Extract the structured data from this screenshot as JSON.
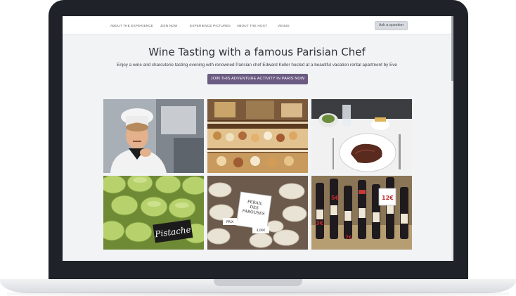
{
  "nav": {
    "items": [
      {
        "label": "About the experience"
      },
      {
        "label": "Join now"
      },
      {
        "label": "Experience pictures"
      },
      {
        "label": "About the host"
      },
      {
        "label": "Venue"
      }
    ],
    "ask_label": "Ask a question"
  },
  "hero": {
    "title": "Wine Tasting with a famous Parisian Chef",
    "subtitle": "Enjoy a wine and charcuterie tasting evening with renowned Parisian chef Edward Keller hosted at a beautiful vacation rental apartment by Eve",
    "cta_label": "JOIN THIS ADVENTURE ACTIVITY IN PARIS NOW"
  },
  "gallery": {
    "photos": [
      {
        "icon": "chef-photo"
      },
      {
        "icon": "pastry-display-photo"
      },
      {
        "icon": "steak-dish-photo"
      },
      {
        "icon": "macarons-photo",
        "label": "Pistache"
      },
      {
        "icon": "cheese-photo",
        "label_lines": [
          "PERAIL",
          "DES",
          "FAROUSES"
        ],
        "tag": "PRIX",
        "price": "3,00€"
      },
      {
        "icon": "wine-bottles-photo",
        "prices": [
          "3€",
          "5€",
          "7€",
          "12€"
        ]
      }
    ]
  },
  "colors": {
    "frame": "#1f2329",
    "screen_bg": "#f2f3f5",
    "cta": "#6b5a82",
    "ask_button": "#d7dbe0"
  }
}
